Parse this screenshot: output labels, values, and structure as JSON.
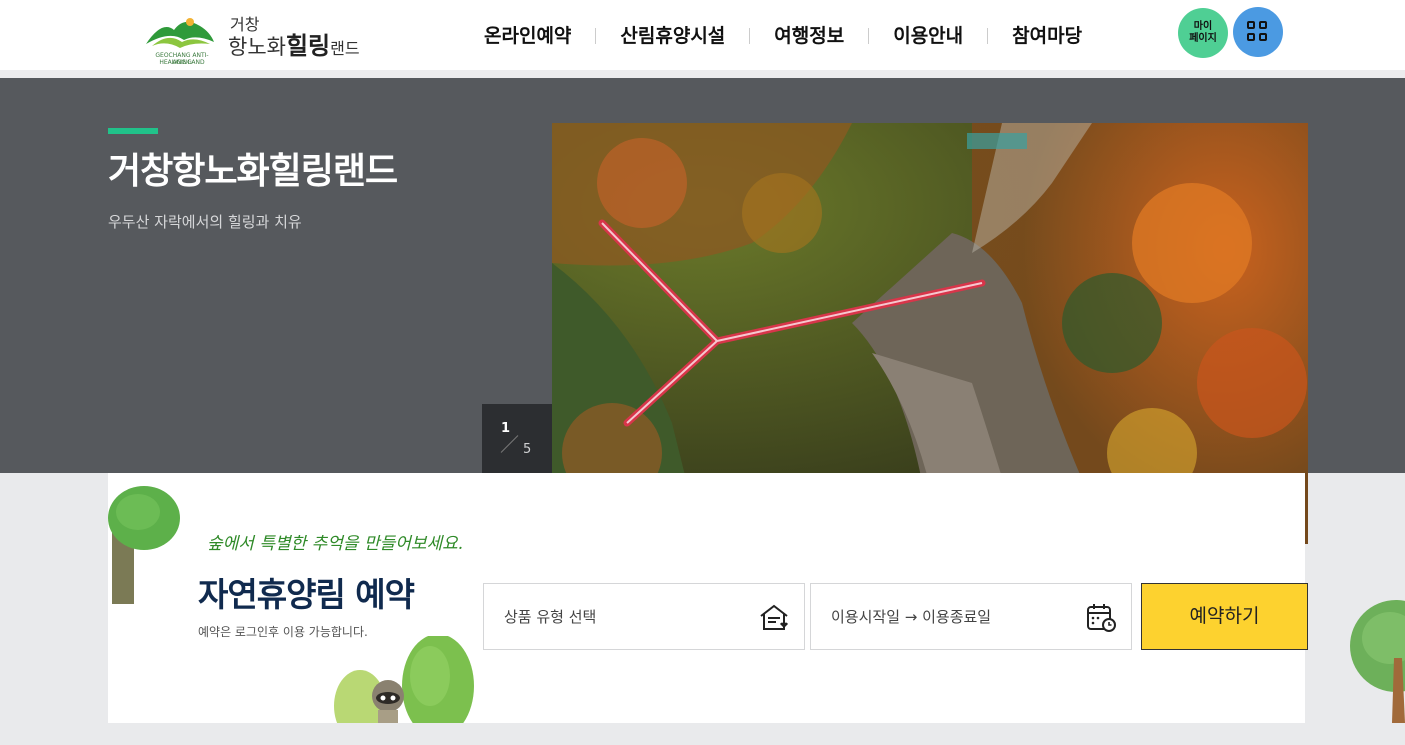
{
  "header": {
    "logo": {
      "line1": "거창",
      "line2_a": "항노화",
      "line2_b": "힐링",
      "line2_c": "랜드",
      "en_line1": "GEOCHANG ANTI-AGING",
      "en_line2": "HEALING LAND"
    },
    "nav": [
      {
        "label": "온라인예약"
      },
      {
        "label": "산림휴양시설"
      },
      {
        "label": "여행정보"
      },
      {
        "label": "이용안내"
      },
      {
        "label": "참여마당"
      }
    ],
    "mypage_line1": "마이",
    "mypage_line2": "페이지",
    "menu_icon": "grid-icon"
  },
  "hero": {
    "title": "거창항노화힐링랜드",
    "subtitle": "우두산 자락에서의 힐링과 치유",
    "pager": {
      "current": "1",
      "total": "5"
    },
    "prev_icon": "arrow-left-icon",
    "next_icon": "arrow-right-icon"
  },
  "reservation": {
    "handwritten": "숲에서 특별한 추억을 만들어보세요.",
    "title": "자연휴양림 예약",
    "note": "예약은 로그인후 이용 가능합니다.",
    "product_label": "상품 유형 선택",
    "product_icon": "house-heart-icon",
    "date_label": "이용시작일 → 이용종료일",
    "date_icon": "calendar-clock-icon",
    "submit_label": "예약하기"
  },
  "colors": {
    "accent_green": "#21c28a",
    "hero_bg": "#56595d",
    "reserve_button": "#fdd22f",
    "mypage_button": "#4fcf94",
    "menu_button": "#4b9ae2",
    "title_navy": "#102a4e"
  }
}
